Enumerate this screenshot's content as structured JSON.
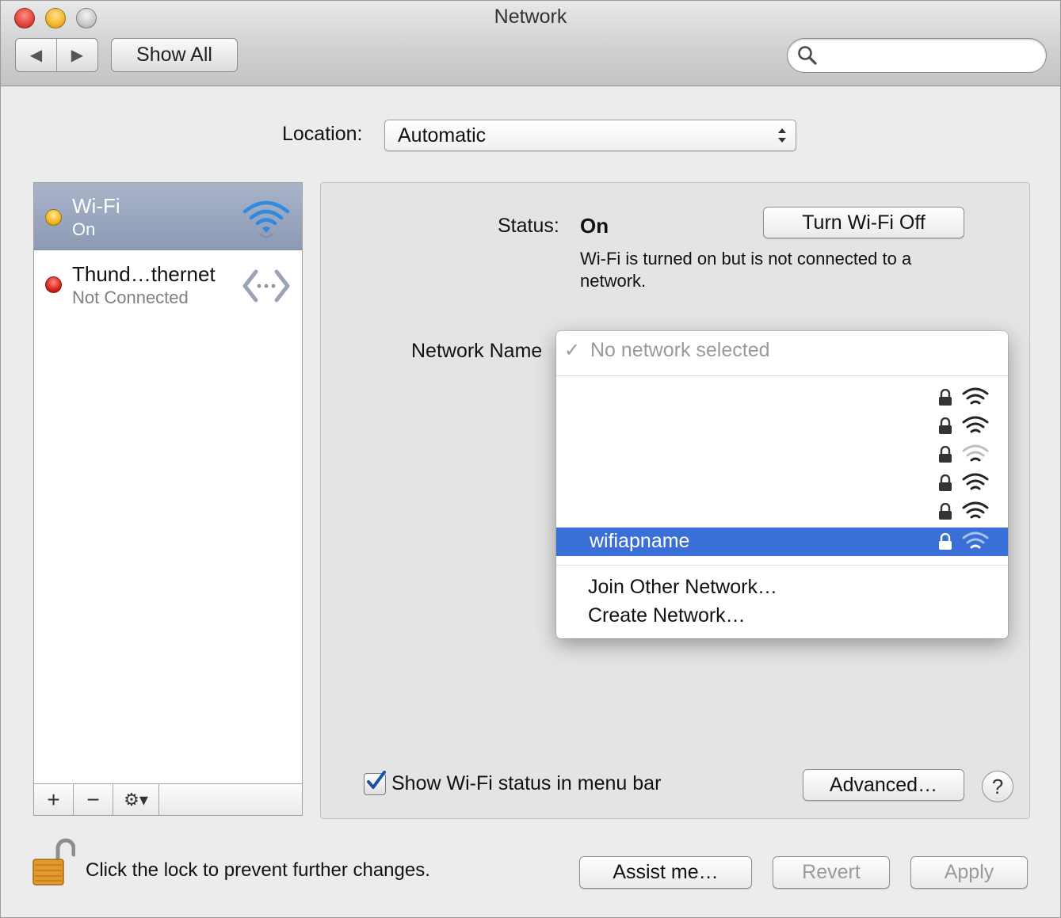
{
  "window": {
    "title": "Network"
  },
  "toolbar": {
    "back_glyph": "◀",
    "forward_glyph": "▶",
    "show_all": "Show All",
    "search_placeholder": ""
  },
  "location": {
    "label": "Location:",
    "value": "Automatic"
  },
  "sidebar": {
    "services": [
      {
        "name": "Wi-Fi",
        "status": "On",
        "dot_color": "#f2b622",
        "icon": "wifi-icon",
        "selected": true
      },
      {
        "name": "Thund…thernet",
        "status": "Not Connected",
        "dot_color": "#d8221a",
        "icon": "ethernet-icon",
        "selected": false
      }
    ],
    "add_glyph": "+",
    "remove_glyph": "−",
    "gear_glyph": "⚙▾"
  },
  "main": {
    "status_label": "Status:",
    "status_value": "On",
    "turn_off_button": "Turn Wi-Fi Off",
    "status_description": "Wi-Fi is turned on but is not connected to a network.",
    "network_name_label": "Network Name",
    "show_status_checkbox": {
      "label": "Show Wi-Fi status in menu bar",
      "checked": true
    },
    "advanced_button": "Advanced…",
    "help_glyph": "?"
  },
  "network_menu": {
    "check_glyph": "✓",
    "selected_placeholder": "No network selected",
    "networks": [
      {
        "name": "wifiapname",
        "highlighted": true,
        "locked": true
      }
    ],
    "join_other": "Join Other Network…",
    "create_network": "Create Network…"
  },
  "footer": {
    "lock_text": "Click the lock to prevent further changes.",
    "assist_button": "Assist me…",
    "revert_button": "Revert",
    "apply_button": "Apply"
  },
  "colors": {
    "selection_blue": "#3a6fd8",
    "sidebar_selected": "#8c9ab5",
    "wifi_icon_blue": "#2f8ae0"
  }
}
